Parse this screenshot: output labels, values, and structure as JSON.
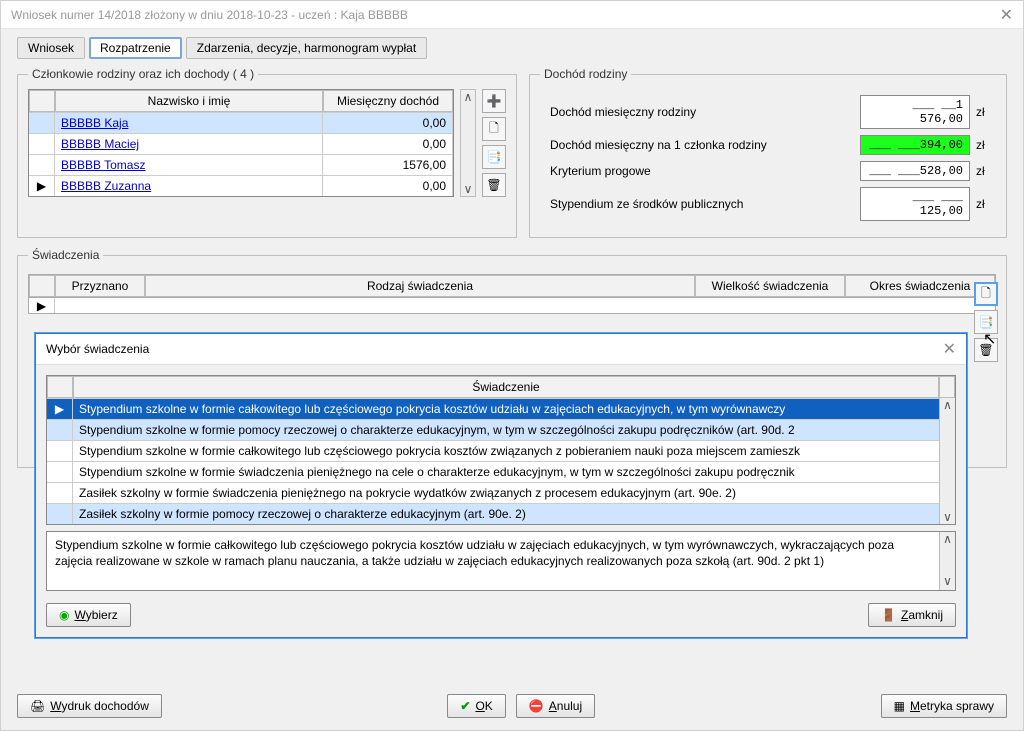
{
  "window_title": "Wniosek numer 14/2018 złożony w dniu 2018-10-23 - uczeń : Kaja BBBBB",
  "tabs": {
    "wniosek": "Wniosek",
    "rozpatrzenie": "Rozpatrzenie",
    "zdarzenia": "Zdarzenia, decyzje, harmonogram wypłat"
  },
  "family_fs": {
    "legend": "Członkowie rodziny oraz ich dochody ( 4 )",
    "col_name": "Nazwisko i imię",
    "col_income": "Miesięczny dochód",
    "rows": [
      {
        "name": "BBBBB Kaja",
        "income": "0,00",
        "selected": true,
        "marker": ""
      },
      {
        "name": "BBBBB Maciej",
        "income": "0,00",
        "selected": false,
        "marker": ""
      },
      {
        "name": "BBBBB Tomasz",
        "income": "1576,00",
        "selected": false,
        "marker": ""
      },
      {
        "name": "BBBBB Zuzanna",
        "income": "0,00",
        "selected": false,
        "marker": "▶"
      }
    ]
  },
  "income_fs": {
    "legend": "Dochód rodziny",
    "lines": {
      "l1_label": "Dochód miesięczny rodziny",
      "l1_val": "___ __1 576,00",
      "l2_label": "Dochód miesięczny na 1 członka rodziny",
      "l2_val": "___ ___394,00",
      "l3_label": "Kryterium progowe",
      "l3_val": "___ ___528,00",
      "l4_label": "Stypendium ze środków publicznych",
      "l4_val": "___ ___ 125,00"
    },
    "unit": "zł"
  },
  "sw_fs": {
    "legend": "Świadczenia",
    "col_prz": "Przyznano",
    "col_rodz": "Rodzaj świadczenia",
    "col_wlk": "Wielkość świadczenia",
    "col_okr": "Okres świadczenia"
  },
  "modal": {
    "title": "Wybór świadczenia",
    "col": "Świadczenie",
    "rows": {
      "r0": "Stypendium szkolne w formie całkowitego lub częściowego pokrycia kosztów udziału w zajęciach edukacyjnych, w tym wyrównawczy",
      "r1": "Stypendium szkolne w formie pomocy rzeczowej o charakterze edukacyjnym, w tym w szczególności zakupu podręczników (art. 90d. 2",
      "r2": "Stypendium szkolne w formie całkowitego lub częściowego pokrycia kosztów związanych z pobieraniem nauki poza miejscem zamieszk",
      "r3": "Stypendium szkolne w formie świadczenia pieniężnego na cele o charakterze edukacyjnym, w tym w szczególności zakupu podręcznik",
      "r4": "Zasiłek szkolny w formie świadczenia pieniężnego na pokrycie wydatków związanych z procesem edukacyjnym (art. 90e. 2)",
      "r5": "Zasiłek szkolny w formie pomocy rzeczowej o charakterze edukacyjnym (art. 90e. 2)"
    },
    "desc": "Stypendium szkolne w formie całkowitego lub częściowego pokrycia kosztów udziału w zajęciach edukacyjnych, w tym wyrównawczych, wykraczających poza zajęcia realizowane w szkole w ramach planu nauczania, a także udziału w zajęciach edukacyjnych realizowanych poza szkołą (art. 90d. 2 pkt 1)",
    "btn_wybierz": "Wybierz",
    "btn_zamknij": "Zamknij"
  },
  "bottom": {
    "wydruk": "Wydruk dochodów",
    "ok": "OK",
    "anuluj": "Anuluj",
    "metryka": "Metryka sprawy"
  }
}
